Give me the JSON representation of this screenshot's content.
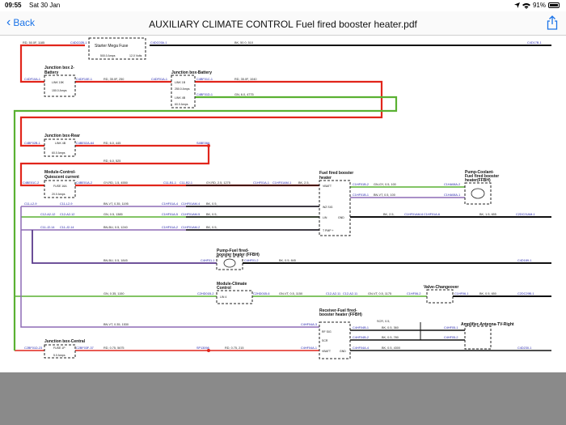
{
  "status": {
    "time": "09:55",
    "date": "Sat 30 Jan",
    "battery": "91%"
  },
  "nav": {
    "back_label": "Back",
    "title": "AUXILIARY CLIMATE CONTROL Fuel fired booster heater.pdf"
  },
  "colors": {
    "red": "#e1251b",
    "green": "#5ab132",
    "purple": "#8e6bb5",
    "black": "#111111",
    "link": "#1a1aa8",
    "accent": "#1a73e8"
  },
  "diagram": {
    "connectors": {
      "c1": "C4DC02B-1",
      "c2": "C4DC03A-1",
      "c3": "C4D17B-1",
      "c4": "C4DF10A-1",
      "c5": "C4DF10E-1",
      "c6": "C4DF01A-1",
      "c7": "C4BF01C-1",
      "c8": "C4BF01D-1",
      "c9": "C4BF02B-1",
      "c10": "C4BE02A-64",
      "c11": "S4BE06A",
      "c12": "C4BE01C-2",
      "c13": "C4BE01A-2",
      "c14": "C11-B1-1",
      "c15": "C11-B2-1",
      "c16": "C1HF01A-1",
      "c17": "C1HF01AM-1",
      "c18": "C11-L2-9",
      "c19": "C11-L2-9",
      "c20": "C1HF01A-4",
      "c21": "C1HF01AM-4",
      "c22": "C12-A2-12",
      "c23": "C12-A2-12",
      "c24": "C1HF01A-5",
      "c25": "C1HF01AM-5",
      "c26": "C11-J2-14",
      "c27": "C11-J2-14",
      "c28": "C1HF01A-2",
      "c29": "C1HF01AM-2",
      "c30": "C1HF01B-2",
      "c31": "C1HF01B-1",
      "c32": "C1HA08A-2",
      "c33": "C1HA08A-1",
      "c34": "C1HF01AM-6",
      "c35": "C1HF01A-6",
      "c36": "C2DC21AM-1",
      "c37": "C4HF01-1",
      "c38": "C4HF01-2",
      "c39": "C4D189-1",
      "c40": "C2HD01B-2",
      "c41": "C2HD01B-6",
      "c42": "C12-A2-11",
      "c43": "C12-A2-11",
      "c44": "C1HF06-2",
      "c45": "C1HF06-1",
      "c46": "C2DC29B-1",
      "c47": "C4HF04A-3",
      "c48": "C4HF04B-1",
      "c49": "C4HF04B-2",
      "c50": "C4HF05-1",
      "c51": "C4HF05-2",
      "c52": "C2BF01D-23",
      "c53": "C2BF03F-37",
      "c54": "SP13098",
      "c55": "C4HF04A-1",
      "c56": "C4HF04A-4",
      "c57": "C4D230-1"
    },
    "wires": {
      "w1": "RD, 50.0F, 1185",
      "w2": "BK, 50.0, 510",
      "w3": "RD, 35.0F, 250",
      "w4": "RD, 35.0F, 1040",
      "w5": "GN, 6.0, 4775",
      "w6": "RD, 6.0, 445",
      "w7": "RD, 6.0, 525",
      "w8": "GY-RD, 1.5, 4550",
      "w9": "GY-RD, 2.5, 1275",
      "w10": "BK, 2.5,",
      "w11": "BN-VT, 0.35, 1195",
      "w12": "BK, 0.5,",
      "w13": "GN, 0.5, 1385",
      "w14": "BK, 0.5,",
      "w15": "BN-BU, 0.5, 1240",
      "w16": "BK, 0.5,",
      "w17": "GN-GY, 0.5, 100",
      "w18": "BN-VT, 0.5, 100",
      "w19": "BK, 2.5,",
      "w20": "BK, 1.5, 655",
      "w21": "BN-BU, 0.5, 1845",
      "w22": "BK, 0.5, 845",
      "w23": "GN, 0.35, 1150",
      "w24": "GN-VT, 0.5, 1150",
      "w25": "GN-VT, 0.5, 1175",
      "w26": "BK, 0.5, 650",
      "w27": "BN-VT, 0.35, 1530",
      "w28": "SCR, 0.5,",
      "w29": "BK, 0.5, 360",
      "w30": "BK, 0.5, 780",
      "w31": "RD, 0.75, 5675",
      "w32": "RD, 0.75, 215",
      "w33": "BK, 0.5, 4300"
    },
    "components": {
      "starter_fuse": "Starter Mega Fuse",
      "starter_rating": "500.0 Amps",
      "starter_volt": "12.0 Volts",
      "jb2_title": "Junction box 2-\nBattery",
      "jb2_link": "LINK 15K",
      "jb2_rating": "150.0 Amps",
      "jbb_title": "Junction box-Battery",
      "jbb_link1": "LINK 1B",
      "jbb_rating1": "250.0 Amps",
      "jbb_link2": "LINK 4B",
      "jbb_rating2": "60.0 Amps",
      "jbr_title": "Junction box-Rear",
      "jbr_link": "LINK 4B",
      "jbr_rating": "60.0 Amps",
      "mcq_title": "Module-Control-\nQuiescent current",
      "mcq_fuse": "FUSE 16A",
      "mcq_rating": "20.0 Amps",
      "ffbh_title": "Fuel fired booster\nheater",
      "ffbh_vbatt": "VBATT",
      "ffbh_wz": "WZ SIG",
      "ffbh_lin": "LIN",
      "ffbh_gnd": "GND",
      "ffbh_tpmp": "T PMP +",
      "pump_coolant": "Pump-Coolant-\nFuel fired booster\nheater(FFBH)",
      "pump_fuel": "Pump-Fuel fired-\nbooster heater (FFBH)",
      "mod_climate": "Module-Climate\nControl",
      "mod_climate_pin": "LIN 4",
      "valve": "Valve-Changeover",
      "receiver": "Receiver-Fuel fired-\nbooster heater (FFBH)",
      "rcv_rf": "RF SIG",
      "rcv_scr": "SCR",
      "rcv_vbatt": "VBATT",
      "rcv_gnd": "GND",
      "amplifier": "Amplifier-Antenna-TV-Right",
      "jbc_title": "Junction box-Central",
      "jbc_fuse": "FUSE 1P",
      "jbc_rating": "5.0 Amps"
    }
  }
}
